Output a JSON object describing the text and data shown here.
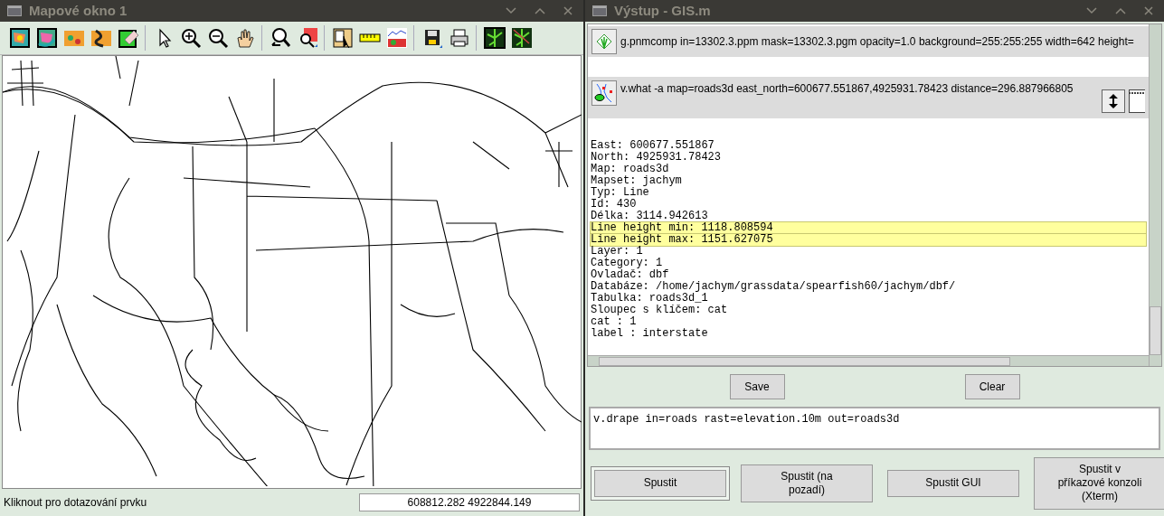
{
  "map_window": {
    "title": "Mapové okno 1",
    "status_text": "Kliknout pro dotazování prvku",
    "coordinates": "608812.282 4922844.149"
  },
  "output_window": {
    "title": "Výstup - GIS.m",
    "commands": [
      {
        "kind": "display",
        "text": "g.pnmcomp in=13302.3.ppm mask=13302.3.pgm opacity=1.0 background=255:255:255 width=642 height="
      },
      {
        "kind": "query",
        "text": "v.what -a map=roads3d east_north=600677.551867,4925931.78423 distance=296.887966805"
      }
    ],
    "output_lines": [
      {
        "text": "East: 600677.551867",
        "highlighted": false
      },
      {
        "text": "North: 4925931.78423",
        "highlighted": false
      },
      {
        "text": "Map: roads3d",
        "highlighted": false
      },
      {
        "text": "Mapset: jachym",
        "highlighted": false
      },
      {
        "text": "Typ: Line",
        "highlighted": false
      },
      {
        "text": "Id: 430",
        "highlighted": false
      },
      {
        "text": "Délka: 3114.942613",
        "highlighted": false
      },
      {
        "text": "Line height min: 1118.808594",
        "highlighted": true
      },
      {
        "text": "Line height max: 1151.627075",
        "highlighted": true
      },
      {
        "text": "Layer: 1",
        "highlighted": false
      },
      {
        "text": "Category: 1",
        "highlighted": false
      },
      {
        "text": "Ovladač: dbf",
        "highlighted": false
      },
      {
        "text": "Databáze: /home/jachym/grassdata/spearfish60/jachym/dbf/",
        "highlighted": false
      },
      {
        "text": "Tabulka: roads3d_1",
        "highlighted": false
      },
      {
        "text": "Sloupec s klíčem: cat",
        "highlighted": false
      },
      {
        "text": "cat : 1",
        "highlighted": false
      },
      {
        "text": "label : interstate",
        "highlighted": false
      }
    ],
    "buttons": [
      "Save",
      "Clear"
    ],
    "command_input": "v.drape in=roads rast=elevation.10m out=roads3d",
    "run_buttons": [
      {
        "label": "Spustit",
        "default": true
      },
      {
        "label": "Spustit (na pozadí)",
        "default": false
      },
      {
        "label": "Spustit GUI",
        "default": false
      },
      {
        "label": "Spustit v příkazové konzoli (Xterm)",
        "default": false
      }
    ]
  }
}
